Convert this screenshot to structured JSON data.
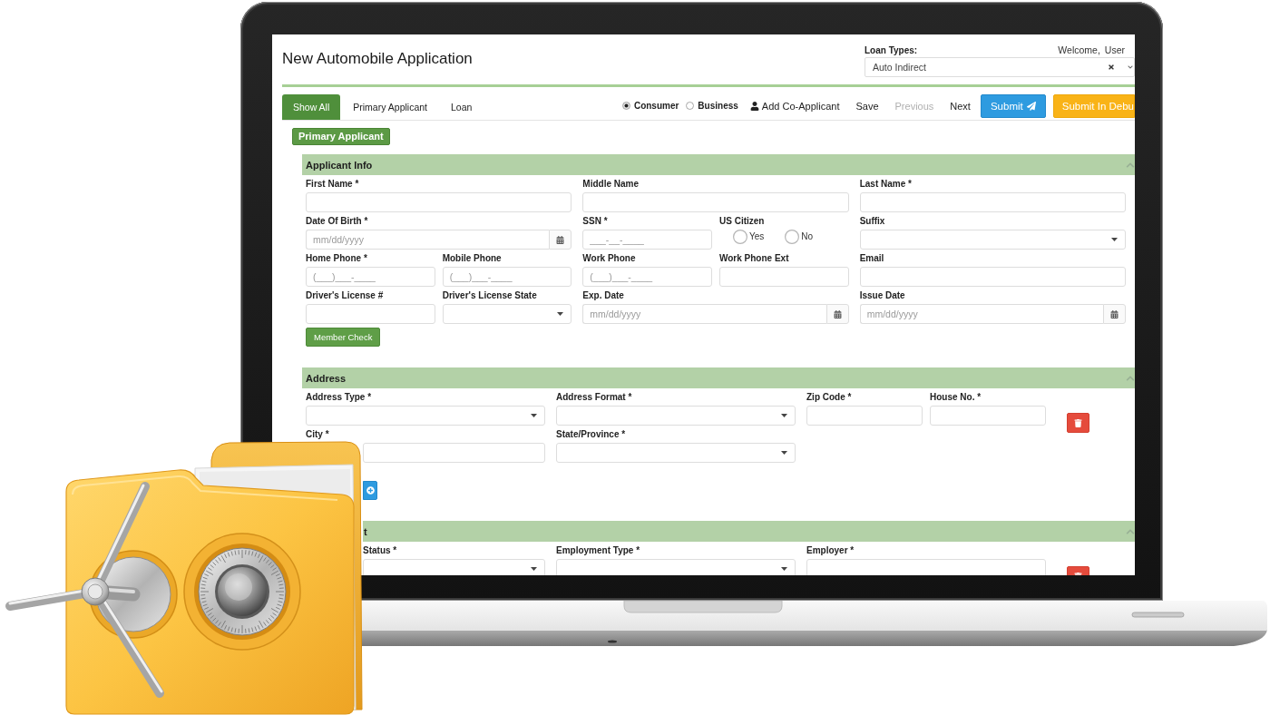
{
  "header": {
    "title": "New Automobile Application",
    "loan_types_label": "Loan Types:",
    "loan_type": "Auto Indirect",
    "welcome": "Welcome,",
    "user": "User"
  },
  "tabs": [
    {
      "label": "Show All",
      "selected": true
    },
    {
      "label": "Primary Applicant",
      "selected": false
    },
    {
      "label": "Loan",
      "selected": false
    }
  ],
  "applicant_type": [
    {
      "label": "Consumer",
      "selected": true
    },
    {
      "label": "Business",
      "selected": false
    }
  ],
  "actions": [
    {
      "kind": "add",
      "label": "Add Co-Applicant",
      "disabled": false
    },
    {
      "kind": "link",
      "label": "Save",
      "disabled": false
    },
    {
      "kind": "link",
      "label": "Previous",
      "disabled": true
    },
    {
      "kind": "link",
      "label": "Next",
      "disabled": false
    },
    {
      "kind": "submit",
      "label": "Submit",
      "disabled": false
    },
    {
      "kind": "debug",
      "label": "Submit In Debu",
      "disabled": false
    }
  ],
  "badge": "Primary Applicant",
  "sections": [
    {
      "title": "Applicant Info",
      "expanded": true,
      "removable": false,
      "rows": [
        [
          [
            {
              "kind": "text",
              "label": "First Name *"
            }
          ],
          [
            {
              "kind": "text",
              "label": "Middle Name"
            }
          ],
          [
            {
              "kind": "text",
              "label": "Last Name *"
            }
          ]
        ],
        [
          [
            {
              "kind": "date",
              "label": "Date Of Birth *",
              "placeholder": "mm/dd/yyyy"
            }
          ],
          [
            {
              "kind": "text",
              "label": "SSN *",
              "placeholder": "___-__-____"
            },
            {
              "kind": "radio",
              "label": "US Citizen",
              "options": [
                {
                  "label": "Yes",
                  "selected": false
                },
                {
                  "label": "No",
                  "selected": false
                }
              ]
            }
          ],
          [
            {
              "kind": "select",
              "label": "Suffix"
            }
          ]
        ],
        [
          [
            {
              "kind": "text",
              "label": "Home Phone *",
              "placeholder": "(___)___-____"
            },
            {
              "kind": "text",
              "label": "Mobile Phone",
              "placeholder": "(___)___-____"
            }
          ],
          [
            {
              "kind": "text",
              "label": "Work Phone",
              "placeholder": "(___)___-____"
            },
            {
              "kind": "text",
              "label": "Work Phone Ext"
            }
          ],
          [
            {
              "kind": "text",
              "label": "Email"
            }
          ]
        ],
        [
          [
            {
              "kind": "text",
              "label": "Driver's License #"
            },
            {
              "kind": "select",
              "label": "Driver's License State"
            }
          ],
          [
            {
              "kind": "date",
              "label": "Exp. Date",
              "placeholder": "mm/dd/yyyy"
            }
          ],
          [
            {
              "kind": "date",
              "label": "Issue Date",
              "placeholder": "mm/dd/yyyy"
            }
          ]
        ]
      ],
      "button": "Member Check"
    },
    {
      "title": "Address",
      "expanded": true,
      "removable": true,
      "addable": true,
      "rows": [
        [
          [
            {
              "kind": "select",
              "label": "Address Type *"
            }
          ],
          [
            {
              "kind": "select",
              "label": "Address Format *"
            }
          ],
          [
            {
              "kind": "text",
              "label": "Zip Code *"
            },
            {
              "kind": "text",
              "label": "House No. *"
            }
          ]
        ],
        [
          [
            {
              "kind": "text",
              "label": "City *",
              "input_covered": true
            }
          ],
          [
            {
              "kind": "select",
              "label": "State/Province *"
            }
          ]
        ]
      ]
    },
    {
      "title": "t",
      "title_covered": true,
      "expanded": true,
      "removable": true,
      "rows": [
        [
          [
            {
              "kind": "select",
              "label": "Status *",
              "label_covered": true,
              "input_covered": true
            }
          ],
          [
            {
              "kind": "select",
              "label": "Employment Type *"
            }
          ],
          [
            {
              "kind": "text",
              "label": "Employer *"
            }
          ]
        ]
      ]
    }
  ]
}
